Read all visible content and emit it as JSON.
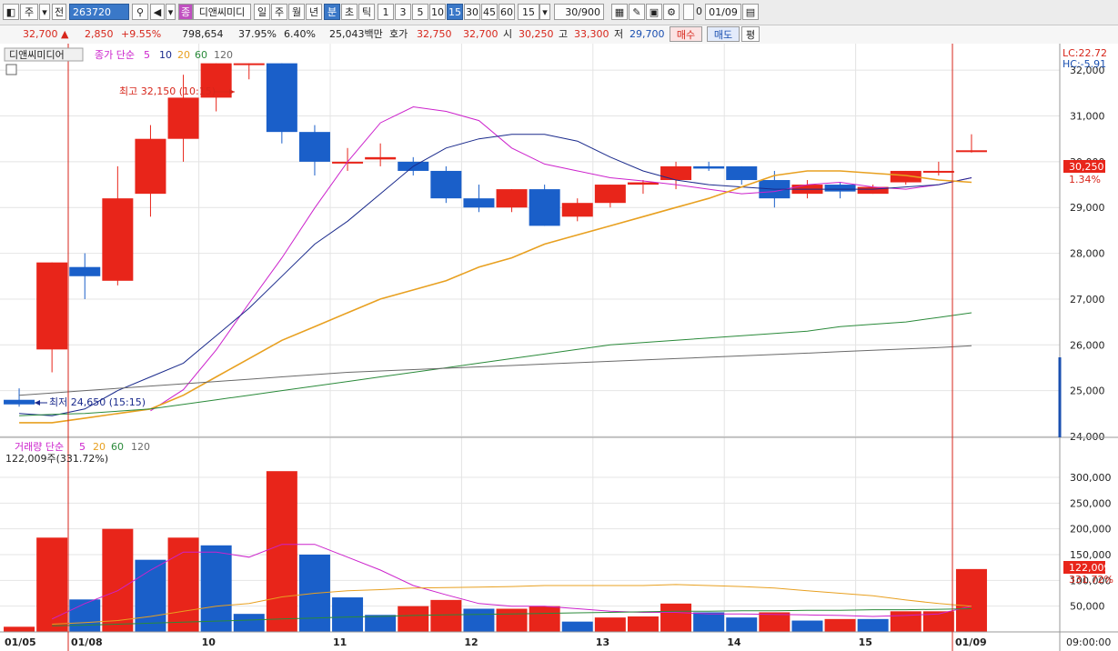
{
  "toolbar": {
    "market": "주",
    "prev_label": "전",
    "code_value": "263720",
    "stock_tag": "종",
    "stock_name": "디앤씨미디",
    "periods": [
      "일",
      "주",
      "월",
      "년",
      "분",
      "초",
      "틱"
    ],
    "minute_options": [
      "1",
      "3",
      "5",
      "10",
      "15",
      "30",
      "45",
      "60"
    ],
    "interval_value": "15",
    "count_value": "30/900",
    "checkbox_label": "0",
    "date_value": "01/09",
    "selected_period": "분",
    "selected_minute": "15"
  },
  "quote": {
    "price": "32,700 ▲",
    "change": "2,850",
    "change_pct": "+9.55%",
    "volume": "798,654",
    "turnover_pct": "37.95%",
    "ratio_pct": "6.40%",
    "amount": "25,043백만",
    "bid_label": "호가",
    "ask": "32,750",
    "bid": "32,700",
    "open_label": "시",
    "open": "30,250",
    "high_label": "고",
    "high": "33,300",
    "low_label": "저",
    "low": "29,700",
    "buy_button": "매수",
    "sell_button": "매도",
    "eval_button": "평"
  },
  "price_panel": {
    "stock_label": "디앤씨미디어",
    "ma_title": "종가 단순",
    "ma_periods": [
      "5",
      "10",
      "20",
      "60",
      "120"
    ],
    "lc": "LC:22.72",
    "hc": "HC:-5.91",
    "current_price": "30,250",
    "current_pct": "1.34%",
    "max_annotation": "최고 32,150 (10:15)",
    "min_annotation": "최저 24,650 (15:15)"
  },
  "volume_panel": {
    "title": "거래량 단순",
    "ma_periods": [
      "5",
      "20",
      "60",
      "120"
    ],
    "info": "122,009주(331.72%)",
    "current_volume": "122,009",
    "current_pct": "331.72%"
  },
  "colors": {
    "up": "#e8251a",
    "down": "#1a5fc9",
    "ma5": "#cc22cc",
    "ma10": "#1a2a8c",
    "ma20": "#e8a020",
    "ma60": "#2a8a3a",
    "ma120": "#6a6a6a"
  },
  "chart_data": [
    {
      "type": "candlestick",
      "title": "디앤씨미디어",
      "x": [
        "01/05",
        "01/08",
        "",
        "",
        "",
        "",
        "",
        "",
        "",
        "",
        "",
        "",
        "",
        "",
        "",
        "",
        "",
        "",
        "",
        "",
        "",
        "",
        "",
        "",
        "",
        "",
        "",
        "",
        "",
        "01/09"
      ],
      "x_tick_labels": [
        "01/05",
        "01/08",
        "10",
        "11",
        "12",
        "13",
        "14",
        "15",
        "01/09"
      ],
      "ohlc": [
        [
          24800,
          25050,
          24650,
          24700
        ],
        [
          25900,
          27800,
          25400,
          27800
        ],
        [
          27700,
          28000,
          27000,
          27500
        ],
        [
          27400,
          29900,
          27300,
          29200
        ],
        [
          29300,
          30800,
          28800,
          30500
        ],
        [
          30500,
          31900,
          30000,
          31400
        ],
        [
          31400,
          32150,
          31100,
          32150
        ],
        [
          32150,
          32150,
          31800,
          32150
        ],
        [
          32150,
          32150,
          30400,
          30650
        ],
        [
          30650,
          30800,
          29700,
          30000
        ],
        [
          30000,
          30300,
          29800,
          30000
        ],
        [
          30050,
          30400,
          29900,
          30100
        ],
        [
          30000,
          30100,
          29700,
          29800
        ],
        [
          29800,
          29900,
          29100,
          29200
        ],
        [
          29200,
          29500,
          28900,
          29000
        ],
        [
          29000,
          29400,
          28900,
          29400
        ],
        [
          29400,
          29500,
          28600,
          28600
        ],
        [
          28800,
          29200,
          28700,
          29100
        ],
        [
          29100,
          29500,
          29000,
          29500
        ],
        [
          29500,
          29600,
          29300,
          29550
        ],
        [
          29600,
          30000,
          29400,
          29900
        ],
        [
          29900,
          30000,
          29800,
          29850
        ],
        [
          29900,
          29900,
          29500,
          29600
        ],
        [
          29600,
          29800,
          29000,
          29200
        ],
        [
          29300,
          29600,
          29200,
          29500
        ],
        [
          29500,
          29550,
          29200,
          29350
        ],
        [
          29300,
          29500,
          29300,
          29450
        ],
        [
          29550,
          29800,
          29500,
          29800
        ],
        [
          29800,
          30000,
          29700,
          29800
        ],
        [
          30250,
          30600,
          30200,
          30250
        ]
      ],
      "series": [
        {
          "name": "5",
          "values": [
            null,
            null,
            null,
            null,
            24560,
            25020,
            25890,
            26910,
            27900,
            28990,
            30000,
            30850,
            31200,
            31100,
            30900,
            30300,
            29950,
            29800,
            29650,
            29580,
            29500,
            29400,
            29300,
            29350,
            29500,
            29550,
            29450,
            29400,
            29500,
            29650
          ]
        },
        {
          "name": "10",
          "values": [
            24500,
            24450,
            24600,
            25000,
            25300,
            25600,
            26200,
            26800,
            27500,
            28200,
            28700,
            29300,
            29900,
            30300,
            30500,
            30600,
            30600,
            30450,
            30100,
            29800,
            29600,
            29500,
            29450,
            29400,
            29400,
            29400,
            29400,
            29450,
            29500,
            29650
          ]
        },
        {
          "name": "20",
          "values": [
            24300,
            24300,
            24400,
            24500,
            24600,
            24900,
            25300,
            25700,
            26100,
            26400,
            26700,
            27000,
            27200,
            27400,
            27700,
            27900,
            28200,
            28400,
            28600,
            28800,
            29000,
            29200,
            29450,
            29700,
            29800,
            29800,
            29750,
            29700,
            29600,
            29550
          ]
        },
        {
          "name": "60",
          "values": [
            24450,
            24480,
            24500,
            24550,
            24600,
            24700,
            24800,
            24900,
            25000,
            25100,
            25200,
            25300,
            25400,
            25500,
            25600,
            25700,
            25800,
            25900,
            26000,
            26050,
            26100,
            26150,
            26200,
            26250,
            26300,
            26400,
            26450,
            26500,
            26600,
            26700
          ]
        },
        {
          "name": "120",
          "values": [
            24900,
            24950,
            25000,
            25050,
            25100,
            25150,
            25200,
            25250,
            25300,
            25350,
            25400,
            25430,
            25460,
            25490,
            25520,
            25550,
            25580,
            25610,
            25640,
            25670,
            25700,
            25730,
            25760,
            25790,
            25820,
            25850,
            25880,
            25910,
            25940,
            25980
          ]
        }
      ],
      "ylim": [
        24000,
        32500
      ],
      "y_ticks": [
        "24,000",
        "25,000",
        "26,000",
        "27,000",
        "28,000",
        "29,000",
        "30,000",
        "31,000",
        "32,000"
      ]
    },
    {
      "type": "bar",
      "title": "거래량 단순",
      "values": [
        10000,
        183000,
        63000,
        200000,
        140000,
        183000,
        168000,
        35000,
        312000,
        150000,
        67000,
        33000,
        50000,
        62000,
        45000,
        45000,
        50000,
        20000,
        28000,
        30000,
        55000,
        38000,
        28000,
        38000,
        22000,
        25000,
        25000,
        40000,
        40000,
        122009
      ],
      "up": [
        true,
        true,
        false,
        true,
        false,
        true,
        false,
        false,
        true,
        false,
        false,
        false,
        true,
        true,
        false,
        true,
        true,
        false,
        true,
        true,
        true,
        false,
        false,
        true,
        false,
        true,
        false,
        true,
        true,
        true
      ],
      "series": [
        {
          "name": "5",
          "values": [
            null,
            null,
            null,
            null,
            null,
            null,
            null,
            null,
            null,
            null,
            null,
            null,
            null,
            null,
            null,
            null,
            null,
            null,
            null,
            null,
            null,
            null,
            null,
            null,
            null,
            null,
            null,
            null,
            null,
            null
          ]
        }
      ],
      "ma5": [
        null,
        25000,
        55000,
        80000,
        120000,
        155000,
        155000,
        145000,
        170000,
        170000,
        145000,
        120000,
        90000,
        72000,
        55000,
        50000,
        50000,
        45000,
        40000,
        38000,
        38000,
        35000,
        35000,
        34000,
        33000,
        32000,
        30000,
        32000,
        35000,
        50000
      ],
      "ma20": [
        null,
        15000,
        18000,
        22000,
        30000,
        40000,
        50000,
        55000,
        68000,
        75000,
        80000,
        82000,
        85000,
        86000,
        87000,
        88000,
        90000,
        90000,
        90000,
        90000,
        92000,
        90000,
        88000,
        85000,
        80000,
        75000,
        70000,
        62000,
        55000,
        50000
      ],
      "ma60": [
        null,
        12000,
        13000,
        15000,
        17000,
        19000,
        21000,
        23000,
        25000,
        27000,
        29000,
        30000,
        32000,
        33000,
        34000,
        35000,
        36000,
        37000,
        38000,
        39000,
        40000,
        40000,
        41000,
        41000,
        42000,
        42000,
        43000,
        43000,
        44000,
        45000
      ],
      "ylim": [
        0,
        330000
      ],
      "y_ticks": [
        "50,000",
        "100,000",
        "150,000",
        "200,000",
        "250,000",
        "300,000"
      ],
      "x_tick_labels": [
        "01/05",
        "01/08",
        "10",
        "11",
        "12",
        "13",
        "14",
        "15",
        "01/09"
      ],
      "time_label": "09:00:00"
    }
  ]
}
